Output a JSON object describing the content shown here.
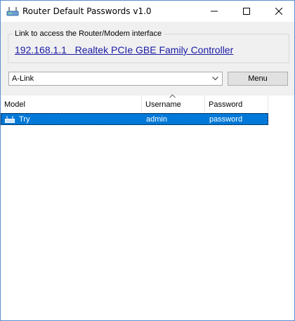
{
  "window": {
    "title": "Router Default Passwords v1.0"
  },
  "link_group": {
    "label": "Link to access the Router/Modem interface",
    "link_text": "192.168.1.1   Realtek PCIe GBE Family Controller"
  },
  "brand_select": {
    "value": "A-Link"
  },
  "menu_button": {
    "label": "Menu"
  },
  "list": {
    "columns": [
      "Model",
      "Username",
      "Password"
    ],
    "sorted_column": "Username",
    "rows": [
      {
        "model": "Try",
        "username": "admin",
        "password": "password",
        "selected": true,
        "icon": "router-icon"
      }
    ]
  },
  "colors": {
    "selection": "#0078d7",
    "link": "#1a1aa6",
    "window_bg": "#f0f0f0"
  }
}
